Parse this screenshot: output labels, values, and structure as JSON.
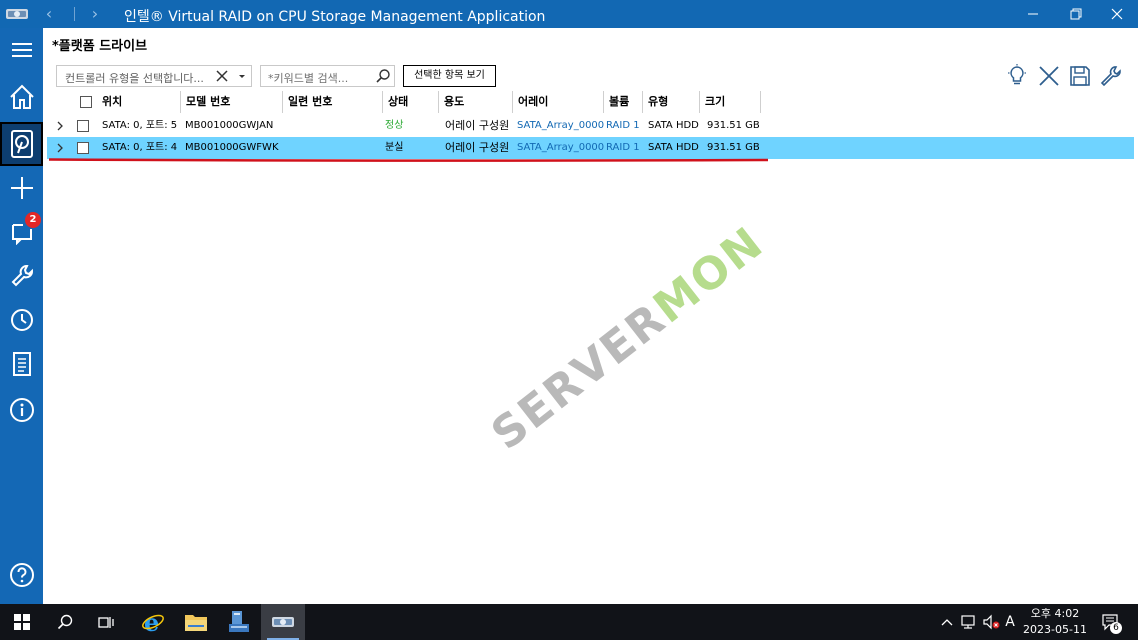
{
  "window": {
    "title": "인텔® Virtual RAID on CPU Storage Management Application"
  },
  "sidebar": {
    "notification_count": "2"
  },
  "page": {
    "title": "*플랫폼 드라이브"
  },
  "toolbar": {
    "controller_placeholder": "컨트롤러 유형을 선택합니다...",
    "search_placeholder": "*키워드별 검색...",
    "view_selected_label": "선택한 항목 보기"
  },
  "table": {
    "headers": {
      "location": "위치",
      "model": "모델 번호",
      "serial": "일련 번호",
      "status": "상태",
      "usage": "용도",
      "array": "어레이",
      "volume": "볼륨",
      "type": "유형",
      "size": "크기"
    },
    "rows": [
      {
        "location": "SATA: 0, 포트: 5",
        "model": "MB001000GWJAN",
        "serial": "",
        "status": "정상",
        "usage": "어레이 구성원",
        "array": "SATA_Array_0000",
        "volume": "RAID 1",
        "type": "SATA HDD",
        "size": "931.51 GB"
      },
      {
        "location": "SATA: 0, 포트: 4",
        "model": "MB001000GWFWK",
        "serial": "",
        "status": "분실",
        "usage": "어레이 구성원",
        "array": "SATA_Array_0000",
        "volume": "RAID 1",
        "type": "SATA HDD",
        "size": "931.51 GB"
      }
    ]
  },
  "watermark": {
    "part1": "SERVER",
    "part2": "MON"
  },
  "taskbar": {
    "notification_count": "6",
    "ime": "A",
    "time": "오후 4:02",
    "date": "2023-05-11"
  },
  "colors": {
    "accent": "#1268b3",
    "sidebar": "#1468b5",
    "selected_row": "#6fd3ff",
    "status_ok": "#2eaa36",
    "annotation": "#d0111b"
  }
}
